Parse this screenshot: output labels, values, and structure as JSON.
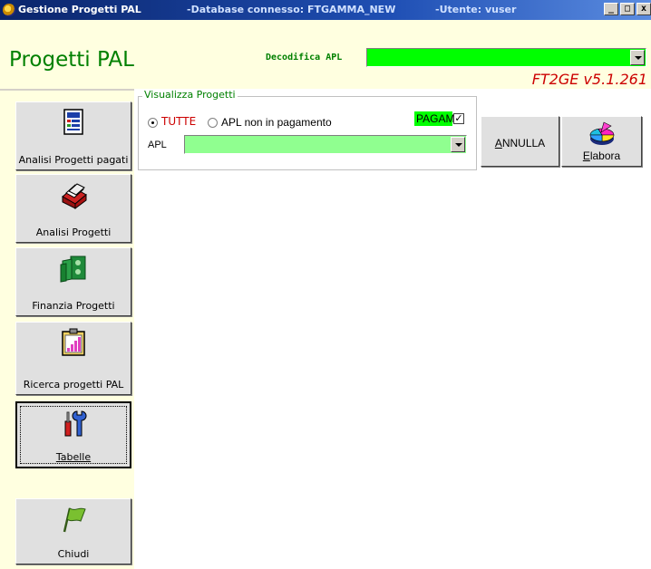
{
  "window": {
    "title": "Gestione Progetti PAL",
    "database": "-Database connesso: FTGAMMA_NEW",
    "user": "-Utente: vuser",
    "buttons": [
      "_",
      "□",
      "x"
    ]
  },
  "header": {
    "app_title": "Progetti PAL",
    "decodifica_label": "Decodifica APL",
    "decodifica_value": "",
    "version": "FT2GE v5.1.261"
  },
  "sidebar": {
    "items": [
      {
        "label": "Analisi Progetti pagati",
        "icon": "report-icon"
      },
      {
        "label": "Analisi Progetti",
        "icon": "card-file-icon"
      },
      {
        "label": "Finanzia Progetti",
        "icon": "money-icon"
      },
      {
        "label": "Ricerca progetti PAL",
        "icon": "chart-clipboard-icon"
      },
      {
        "label": "Tabelle",
        "icon": "tools-icon",
        "active": true
      },
      {
        "label": "Chiudi",
        "icon": "flag-icon"
      }
    ]
  },
  "main": {
    "group_label": "Visualizza Progetti",
    "radio_all": {
      "label": "TUTTE",
      "checked": true
    },
    "radio_unpaid": {
      "label": "APL non in pagamento",
      "checked": false
    },
    "pagam": {
      "label": "PAGAM",
      "checked": true,
      "mark": "✓"
    },
    "apl_label": "APL",
    "apl_value": "",
    "annulla": {
      "label": "ANNULLA",
      "underline": "A",
      "rest": "NNULLA"
    },
    "elabora": {
      "label": "Elabora",
      "underline": "E",
      "rest": "labora"
    }
  },
  "colors": {
    "header_bg": "#ffffe0",
    "title_green": "#008000",
    "combo_green": "#00ff00",
    "apl_combo_green": "#90ff90",
    "version_red": "#cc0000"
  }
}
